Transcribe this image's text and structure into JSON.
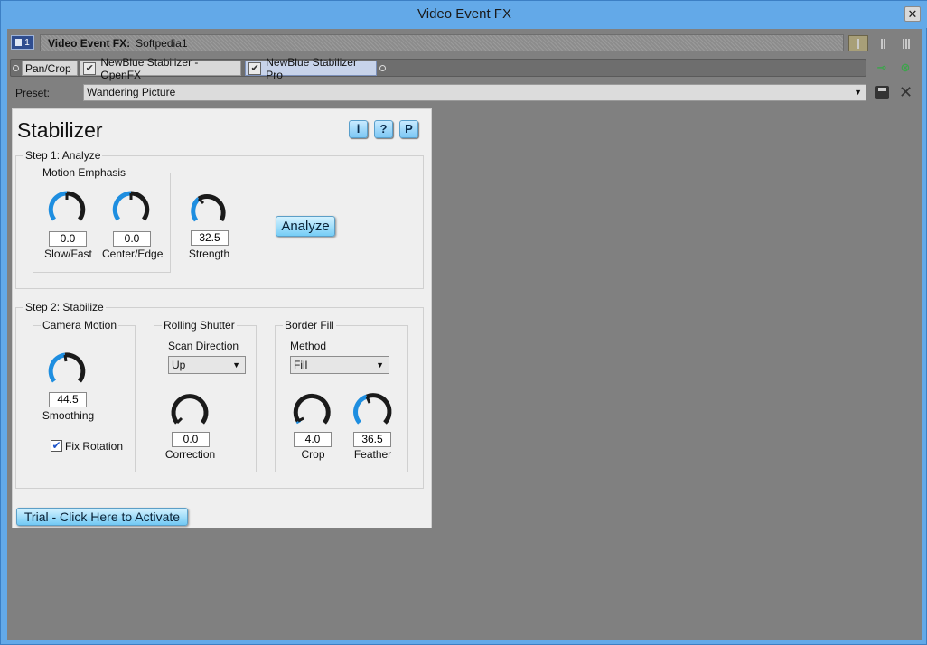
{
  "window": {
    "title": "Video Event FX",
    "close_glyph": "✕"
  },
  "header": {
    "track_number": "1",
    "label": "Video Event FX:",
    "value": "Softpedia1"
  },
  "chain": {
    "plugins": [
      {
        "label": "Pan/Crop",
        "checked": false,
        "selected": false
      },
      {
        "label": "NewBlue Stabilizer - OpenFX",
        "checked": true,
        "selected": false
      },
      {
        "label": "NewBlue Stabilizer Pro",
        "checked": true,
        "selected": true
      }
    ],
    "check_glyph": "✔"
  },
  "preset": {
    "label": "Preset:",
    "value": "Wandering Picture",
    "arrow": "▼"
  },
  "plugin": {
    "title": "Stabilizer",
    "help_buttons": [
      "i",
      "?",
      "P"
    ],
    "step1": {
      "label": "Step 1: Analyze",
      "motion_emphasis": {
        "label": "Motion Emphasis",
        "slow_fast": {
          "value": "0.0",
          "label": "Slow/Fast"
        },
        "center_edge": {
          "value": "0.0",
          "label": "Center/Edge"
        }
      },
      "strength": {
        "value": "32.5",
        "label": "Strength"
      },
      "analyze_label": "Analyze"
    },
    "step2": {
      "label": "Step 2: Stabilize",
      "camera_motion": {
        "label": "Camera Motion",
        "smoothing": {
          "value": "44.5",
          "label": "Smoothing"
        },
        "fix_rotation": {
          "label": "Fix Rotation",
          "checked": true
        }
      },
      "rolling_shutter": {
        "label": "Rolling Shutter",
        "scan_direction_label": "Scan Direction",
        "scan_direction_value": "Up",
        "correction": {
          "value": "0.0",
          "label": "Correction"
        }
      },
      "border_fill": {
        "label": "Border Fill",
        "method_label": "Method",
        "method_value": "Fill",
        "crop": {
          "value": "4.0",
          "label": "Crop"
        },
        "feather": {
          "value": "36.5",
          "label": "Feather"
        }
      }
    },
    "trial_label": "Trial - Click Here to Activate"
  },
  "colors": {
    "knob_active": "#1e8ee0",
    "knob_track": "#1a1a1a",
    "accent_button": "#76cdf6"
  }
}
